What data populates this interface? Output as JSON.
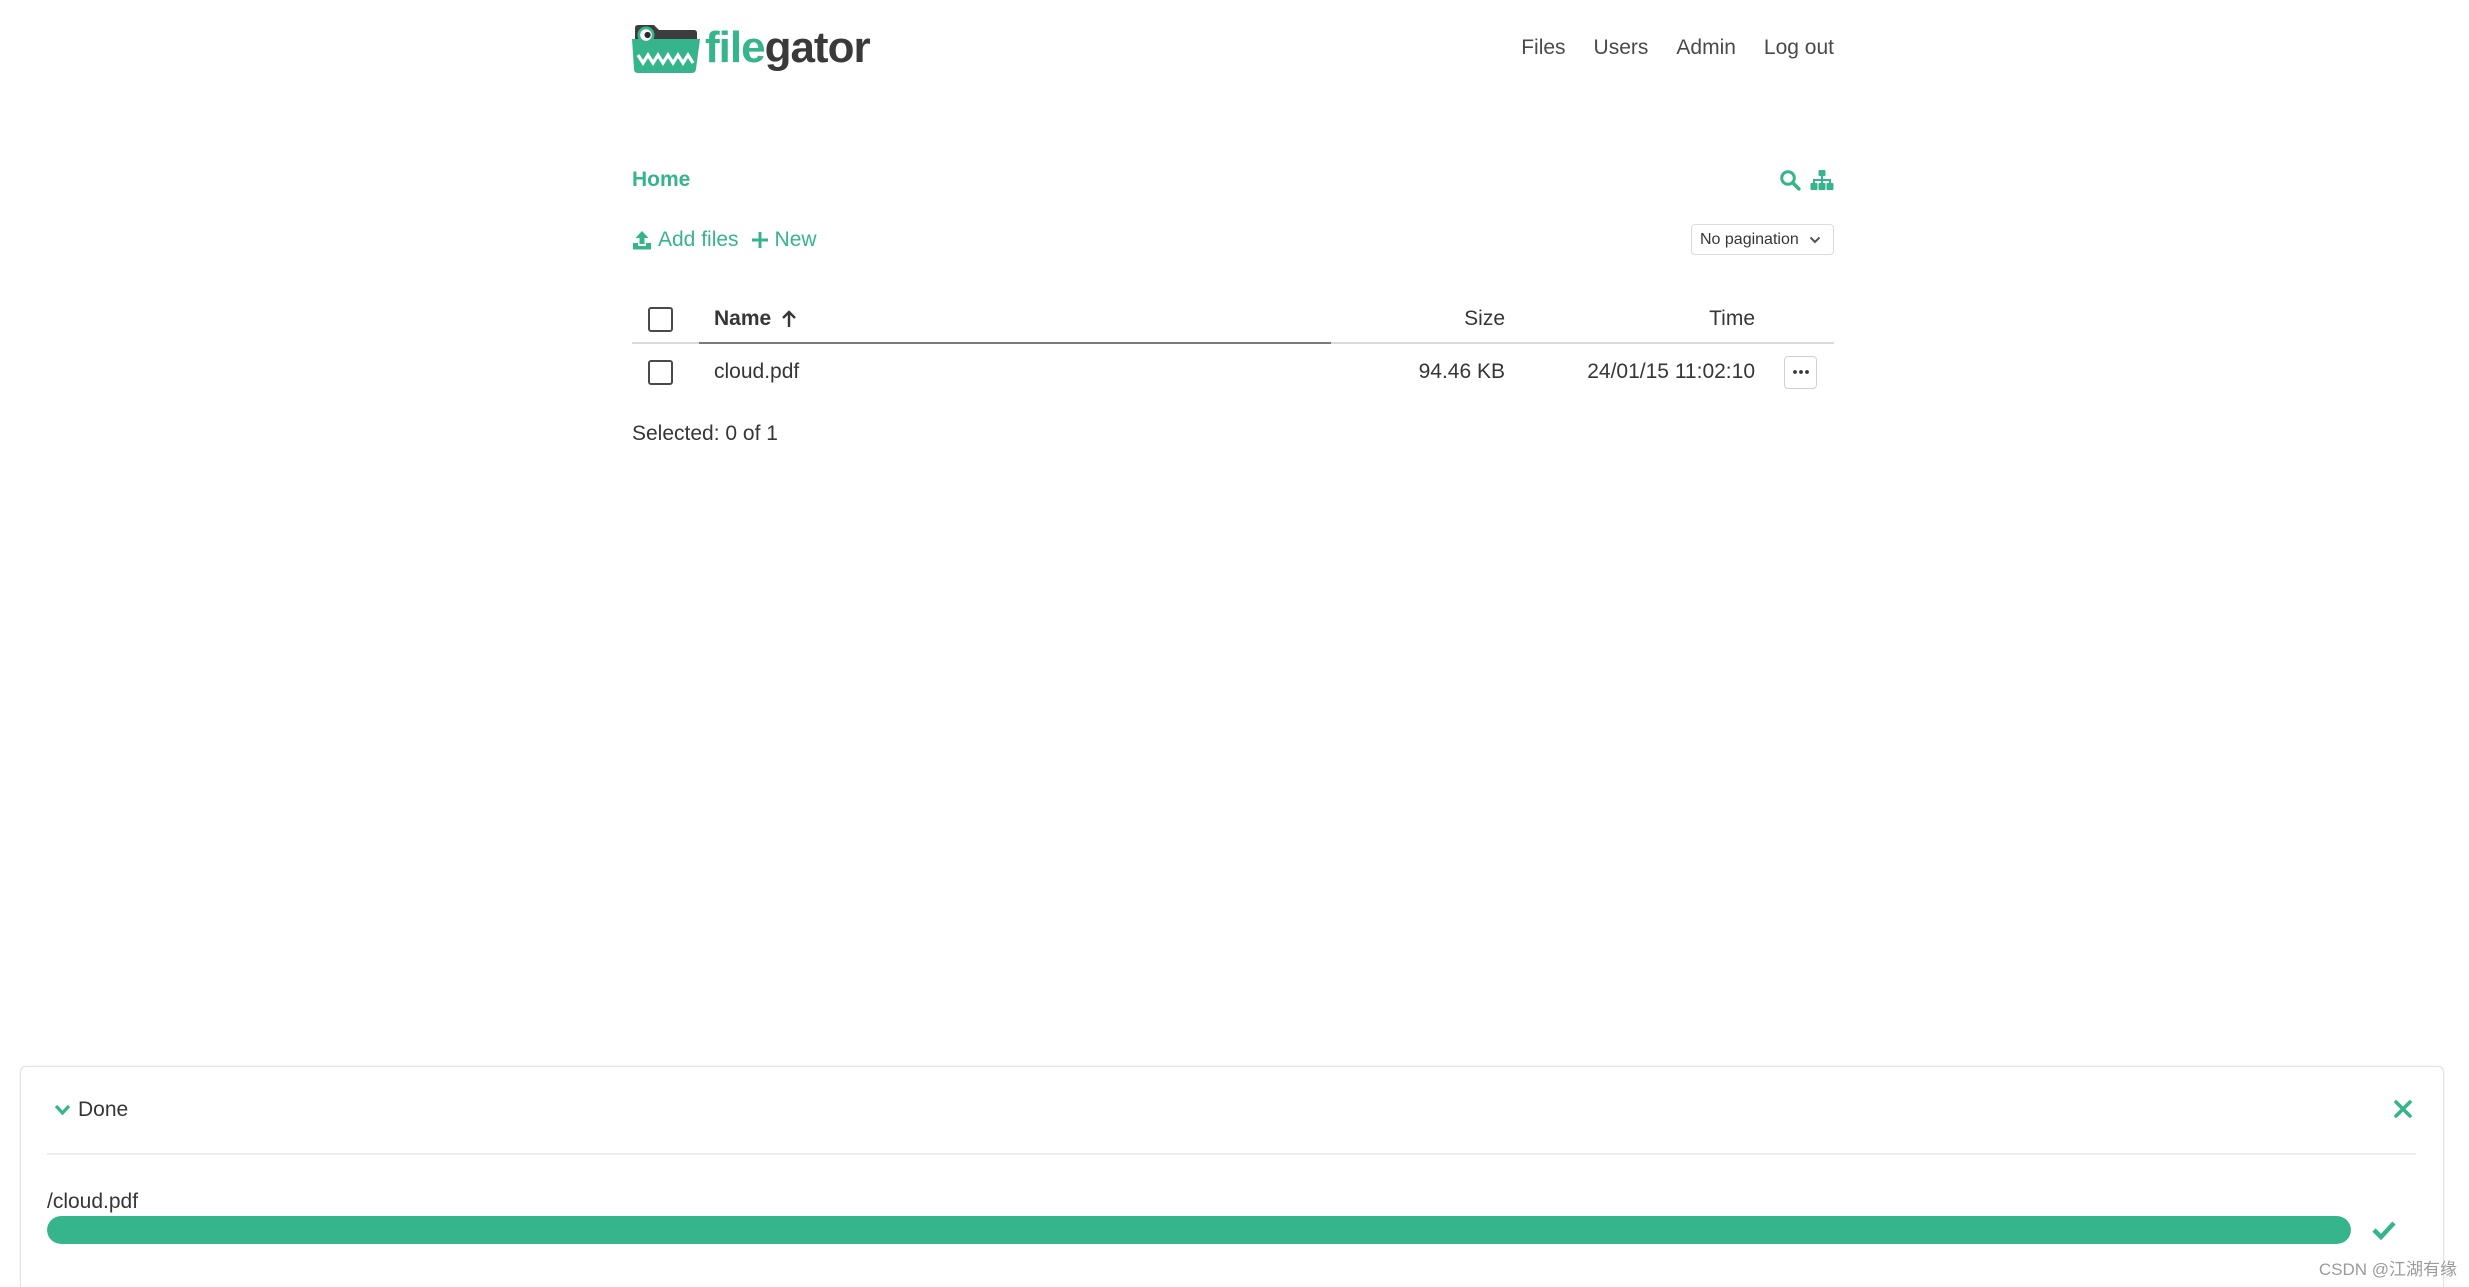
{
  "brand": {
    "name_part1": "file",
    "name_part2": "gator",
    "logo_icon": "gator-folder-icon"
  },
  "nav": {
    "items": [
      {
        "label": "Files"
      },
      {
        "label": "Users"
      },
      {
        "label": "Admin"
      },
      {
        "label": "Log out"
      }
    ]
  },
  "breadcrumb": {
    "items": [
      {
        "label": "Home"
      }
    ]
  },
  "toolbar": {
    "search_icon": "search-icon",
    "tree_icon": "sitemap-icon",
    "add_files": {
      "label": "Add files",
      "icon": "upload-icon"
    },
    "new": {
      "label": "New",
      "icon": "plus-icon"
    },
    "pagination": {
      "selected": "No pagination",
      "icon": "chevron-down-icon"
    }
  },
  "table": {
    "select_all_checked": false,
    "columns": {
      "name": "Name",
      "size": "Size",
      "time": "Time"
    },
    "sort_icon": "arrow-up-icon",
    "rows": [
      {
        "checked": false,
        "name": "cloud.pdf",
        "size": "94.46 KB",
        "time": "24/01/15 11:02:10",
        "actions_icon": "ellipsis-icon"
      }
    ]
  },
  "selection_status": "Selected: 0 of 1",
  "upload_panel": {
    "status": "Done",
    "collapse_icon": "chevron-down-icon",
    "close_icon": "close-icon",
    "files": [
      {
        "path": "/cloud.pdf",
        "progress_percent": 100,
        "status_icon": "check-icon"
      }
    ]
  },
  "watermark": "CSDN @江湖有缘",
  "colors": {
    "accent": "#36b58c",
    "text": "#363636",
    "watermark": "#9b9b9b"
  }
}
